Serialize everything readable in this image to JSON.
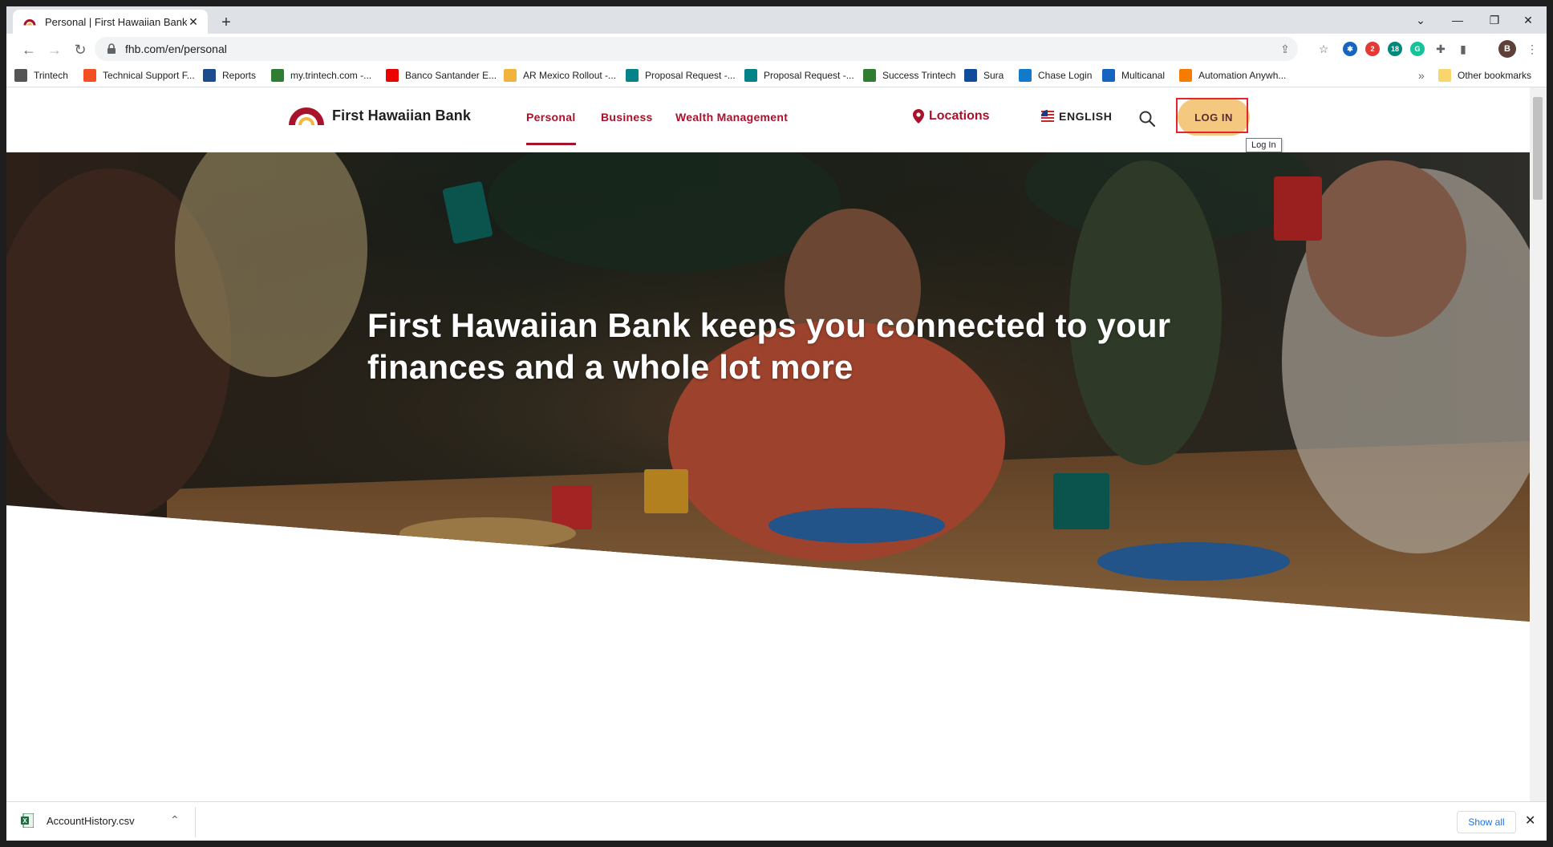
{
  "browser": {
    "tab_title": "Personal | First Hawaiian Bank",
    "url": "fhb.com/en/personal",
    "profile_initial": "B",
    "extension_badges": [
      "2",
      "18"
    ],
    "bookmarks": [
      {
        "label": "Trintech",
        "icon": "trintech-icon",
        "color": "#555555"
      },
      {
        "label": "Technical Support F...",
        "icon": "microsoft-icon",
        "color": "#f25022"
      },
      {
        "label": "Reports",
        "icon": "reports-icon",
        "color": "#1d4c8c"
      },
      {
        "label": "my.trintech.com -...",
        "icon": "trintech-icon",
        "color": "#2e7d32"
      },
      {
        "label": "Banco Santander E...",
        "icon": "santander-icon",
        "color": "#ec0000"
      },
      {
        "label": "AR Mexico Rollout -...",
        "icon": "folder-app-icon",
        "color": "#f2b33d"
      },
      {
        "label": "Proposal Request -...",
        "icon": "forms-icon",
        "color": "#038387"
      },
      {
        "label": "Proposal Request -...",
        "icon": "forms-icon",
        "color": "#038387"
      },
      {
        "label": "Success Trintech",
        "icon": "trintech-icon",
        "color": "#2e7d32"
      },
      {
        "label": "Sura",
        "icon": "sura-icon",
        "color": "#0f4c9c"
      },
      {
        "label": "Chase Login",
        "icon": "chase-icon",
        "color": "#117aca"
      },
      {
        "label": "Multicanal",
        "icon": "multicanal-icon",
        "color": "#1565c0"
      },
      {
        "label": "Automation Anywh...",
        "icon": "automation-anywhere-icon",
        "color": "#f57c00"
      }
    ],
    "other_bookmarks": "Other bookmarks",
    "overflow": "»"
  },
  "site": {
    "logo_text": "First Hawaiian Bank",
    "nav": {
      "personal": "Personal",
      "business": "Business",
      "wealth": "Wealth Management"
    },
    "locations": "Locations",
    "language": "ENGLISH",
    "login": "LOG IN",
    "tooltip": "Log In",
    "accent_color": "#a8122a",
    "login_color": "#f4c87f"
  },
  "hero": {
    "title": "First Hawaiian Bank keeps you connected to your finances and a whole lot more"
  },
  "downloads": {
    "file_name": "AccountHistory.csv",
    "show_all": "Show all"
  }
}
